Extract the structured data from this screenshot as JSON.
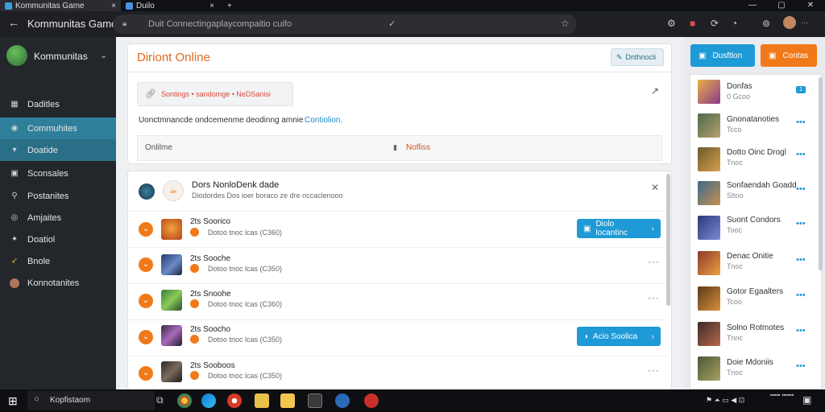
{
  "tabs": [
    {
      "label": "Kommunitas Game"
    },
    {
      "label": "Duilo"
    }
  ],
  "window": {
    "title": "Kommunitas Game"
  },
  "address": {
    "url": "Duit Connectingaplaycompaitio cuifo"
  },
  "sidebar": {
    "profile_name": "Kommunitas",
    "items": [
      {
        "label": "Daditles",
        "icon": "dashboard-icon"
      },
      {
        "label": "Commuhites",
        "icon": "community-icon"
      },
      {
        "label": "Doatide",
        "icon": "chat-icon"
      },
      {
        "label": "Sconsales",
        "icon": "grid-icon"
      },
      {
        "label": "Postanites",
        "icon": "search-icon"
      },
      {
        "label": "Amjaites",
        "icon": "settings-icon"
      },
      {
        "label": "Doatiol",
        "icon": "star-icon"
      },
      {
        "label": "Bnole",
        "icon": "pin-icon"
      },
      {
        "label": "Konnotanites",
        "icon": "avatar-icon"
      }
    ]
  },
  "main": {
    "title": "Diriont Online",
    "title_button": "Dnthnocli",
    "search": {
      "text": "Sontings • sandomge • NeDSanisi"
    },
    "notice": {
      "text": "Uonctmnancde ondcemenme deodinng amnie",
      "link": "Contiolion."
    },
    "status_row": {
      "left": "Onlilme",
      "right": "Nofliss"
    },
    "list_header": {
      "title": "Dors NonloDenk dade",
      "subtitle": "Diodordes Dos ioer boraco ze dre nccaclenooo"
    },
    "rows": [
      {
        "name": "2ts Soorico",
        "meta": "Dotoo tnoc lcas (C360)",
        "button": "Diolo locantinc"
      },
      {
        "name": "2ts Sooche",
        "meta": "Dotoo tnoc lcas (C350)",
        "button": ""
      },
      {
        "name": "2ts Snoohe",
        "meta": "Dotoo tnoc lcas (C360)",
        "button": ""
      },
      {
        "name": "2ts Soocho",
        "meta": "Dotoo tnoc lcas (C350)",
        "button": "Acio Soolica"
      },
      {
        "name": "2ts Sooboos",
        "meta": "Dotoo tnoc lcas (C350)",
        "button": ""
      }
    ]
  },
  "right": {
    "btn_blue": "Dusftlon",
    "btn_orange": "Contas",
    "friends": [
      {
        "name": "Donfas",
        "sub": "0 Gcoo"
      },
      {
        "name": "Gnonatanoties",
        "sub": "Tcco"
      },
      {
        "name": "Dotto Oinc Drogl",
        "sub": "Tnoc"
      },
      {
        "name": "Sonfaendah Goadd",
        "sub": "Sltoo"
      },
      {
        "name": "Suont Condors",
        "sub": "Tooc"
      },
      {
        "name": "Denac Onitie",
        "sub": "Tnoc"
      },
      {
        "name": "Gotor Egaalters",
        "sub": "Tcoo"
      },
      {
        "name": "Solno Rotmotes",
        "sub": "Tnnc"
      },
      {
        "name": "Doie Mdoniis",
        "sub": "Tnoc"
      }
    ]
  },
  "taskbar": {
    "search": "Kopfistaom"
  },
  "colors": {
    "accent_blue": "#1e9ad6",
    "accent_orange": "#f07a1a",
    "sidebar_select": "#2f7f9b"
  }
}
